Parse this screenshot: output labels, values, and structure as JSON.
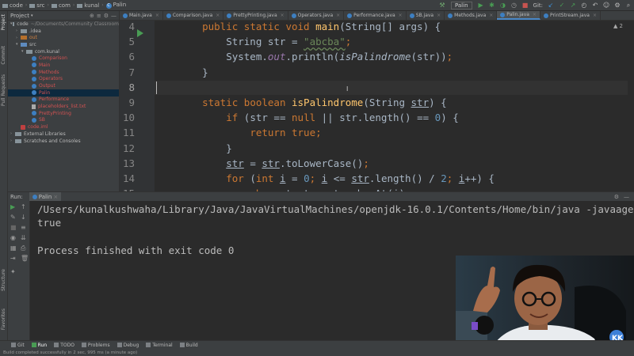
{
  "breadcrumb": [
    "code",
    "src",
    "com",
    "kunal",
    "Palin"
  ],
  "toolbar": {
    "run_config": "Palin",
    "git_label": "Git:"
  },
  "left_strip": [
    "Project",
    "Commit",
    "Pull Requests",
    "Structure",
    "Favorites"
  ],
  "project_panel": {
    "title": "Project",
    "items": [
      {
        "label": "code",
        "path": "~/Documents/Community Classroom",
        "indent": 0,
        "icon": "folder-icon",
        "expanded": true
      },
      {
        "label": ".idea",
        "indent": 1,
        "icon": "folder-icon",
        "expanded": false
      },
      {
        "label": "out",
        "indent": 1,
        "icon": "folder-orange-icon",
        "expanded": false
      },
      {
        "label": "src",
        "indent": 1,
        "icon": "folder-blue-icon",
        "expanded": true
      },
      {
        "label": "com.kunal",
        "indent": 2,
        "icon": "package-icon",
        "expanded": true
      },
      {
        "label": "Comparison",
        "indent": 3,
        "icon": "class-icon"
      },
      {
        "label": "Main",
        "indent": 3,
        "icon": "class-icon"
      },
      {
        "label": "Methods",
        "indent": 3,
        "icon": "class-icon"
      },
      {
        "label": "Operators",
        "indent": 3,
        "icon": "class-icon"
      },
      {
        "label": "Output",
        "indent": 3,
        "icon": "class-icon"
      },
      {
        "label": "Palin",
        "indent": 3,
        "icon": "class-icon",
        "selected": true
      },
      {
        "label": "Performance",
        "indent": 3,
        "icon": "class-icon"
      },
      {
        "label": "placeholders_list.txt",
        "indent": 3,
        "icon": "text-file-icon"
      },
      {
        "label": "PrettyPrinting",
        "indent": 3,
        "icon": "class-icon"
      },
      {
        "label": "SB",
        "indent": 3,
        "icon": "class-icon"
      },
      {
        "label": "code.iml",
        "indent": 1,
        "icon": "iml-file-icon"
      },
      {
        "label": "External Libraries",
        "indent": 0,
        "icon": "library-icon",
        "expanded": false
      },
      {
        "label": "Scratches and Consoles",
        "indent": 0,
        "icon": "scratches-icon",
        "expanded": false
      }
    ]
  },
  "tabs": [
    {
      "label": "Main.java",
      "active": false
    },
    {
      "label": "Comparison.java",
      "active": false
    },
    {
      "label": "PrettyPrinting.java",
      "active": false
    },
    {
      "label": "Operators.java",
      "active": false
    },
    {
      "label": "Performance.java",
      "active": false
    },
    {
      "label": "SB.java",
      "active": false
    },
    {
      "label": "Methods.java",
      "active": false
    },
    {
      "label": "Palin.java",
      "active": true
    },
    {
      "label": "PrintStream.java",
      "active": false
    }
  ],
  "editor": {
    "inspection": "▲ 2",
    "line_numbers": [
      "4",
      "5",
      "6",
      "7",
      "8",
      "9",
      "10",
      "11",
      "12",
      "13",
      "14",
      "15"
    ],
    "current_line": "8"
  },
  "run_panel": {
    "title": "Run:",
    "tab": "Palin",
    "lines": [
      "/Users/kunalkushwaha/Library/Java/JavaVirtualMachines/openjdk-16.0.1/Contents/Home/bin/java -javaagent:/Applic",
      "true",
      "",
      "Process finished with exit code 0"
    ]
  },
  "bottom_tools": [
    "Git",
    "Run",
    "TODO",
    "Problems",
    "Debug",
    "Terminal",
    "Build"
  ],
  "status": "Build completed successfully in 2 sec, 995 ms (a minute ago)",
  "colors": {
    "background": "#2b2b2b",
    "panel": "#3c3f41",
    "keyword": "#cc7832",
    "method": "#ffc66d",
    "string": "#6a8759",
    "static_field": "#9876aa",
    "selection": "#0d293e"
  }
}
